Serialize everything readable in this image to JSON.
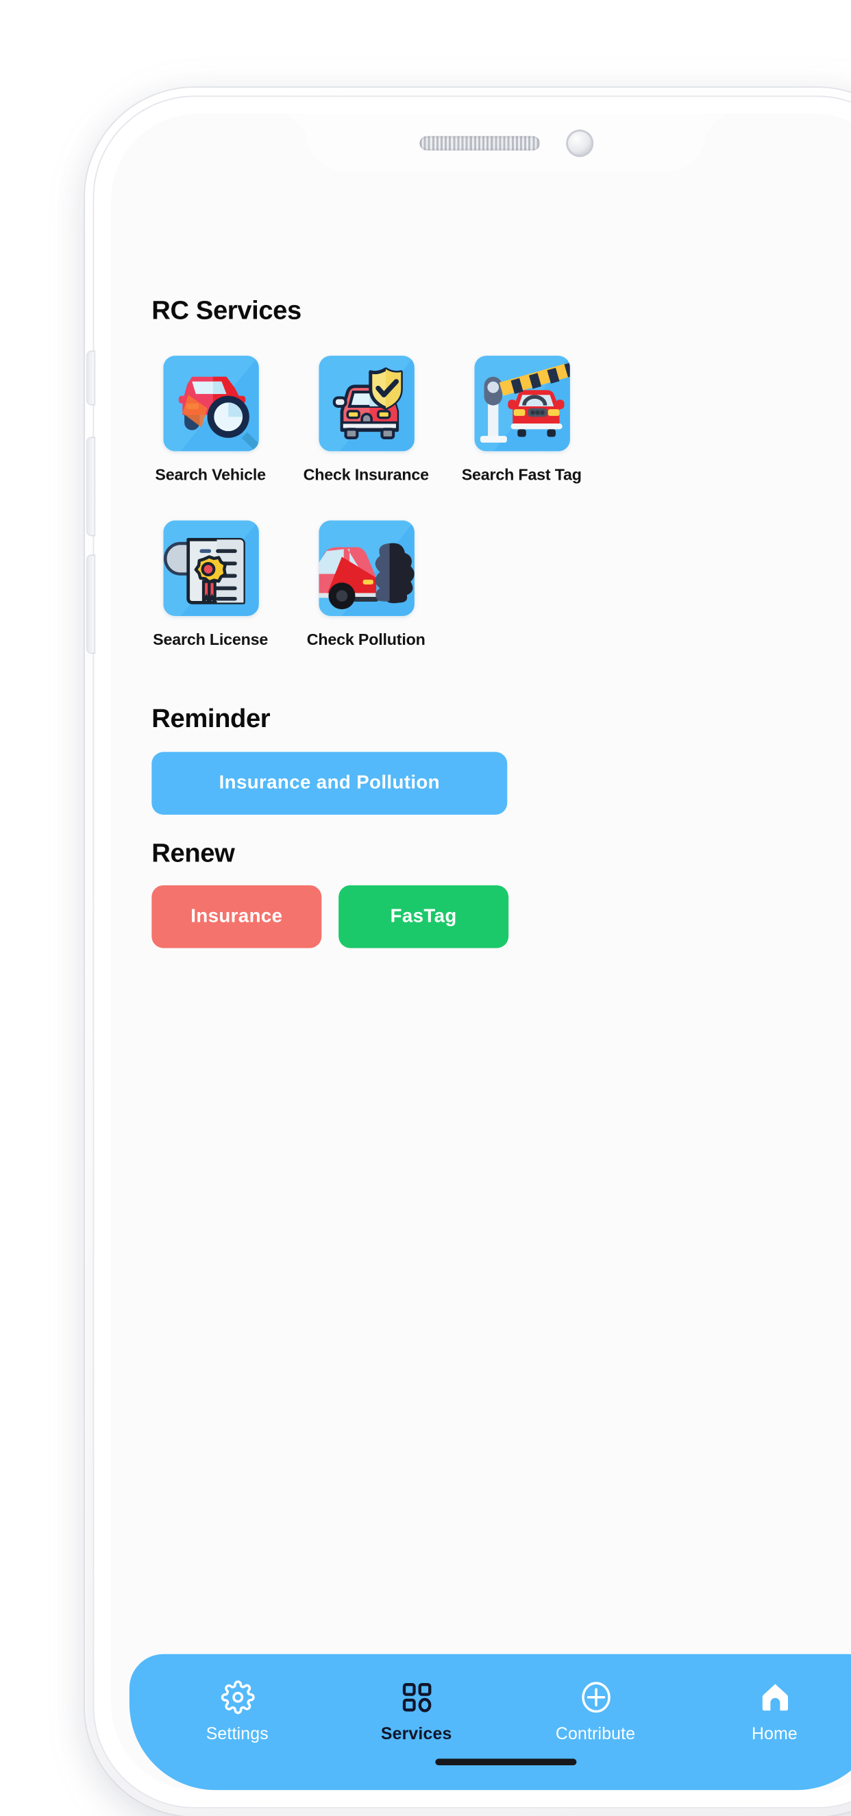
{
  "device": {
    "frame_color": "#f4f4f6",
    "screen_bg": "#fbfbfb",
    "notch": {
      "speaker_icon": "speaker-grille-icon",
      "camera_icon": "front-camera-icon"
    },
    "home_indicator_color": "#16181c"
  },
  "colors": {
    "accent_blue": "#53b9fa",
    "tile_blue": "#56bdf7",
    "renew_insurance_red": "#f4736c",
    "renew_fastag_green": "#1cc96a",
    "text_dark": "#0c0c0c",
    "nav_active": "#10152b",
    "nav_inactive": "#ffffff"
  },
  "sections": {
    "rc_services": {
      "title": "RC Services",
      "items": [
        {
          "label": "Search Vehicle",
          "icon": "car-magnifier-icon"
        },
        {
          "label": "Check Insurance",
          "icon": "car-shield-check-icon"
        },
        {
          "label": "Search Fast Tag",
          "icon": "toll-barrier-car-icon"
        },
        {
          "label": "Search License",
          "icon": "certificate-rosette-icon"
        },
        {
          "label": "Check Pollution",
          "icon": "car-exhaust-smoke-icon"
        }
      ]
    },
    "reminder": {
      "title": "Reminder",
      "button_label": "Insurance and Pollution"
    },
    "renew": {
      "title": "Renew",
      "buttons": [
        {
          "label": "Insurance",
          "color": "#f4736c"
        },
        {
          "label": "FasTag",
          "color": "#1cc96a"
        }
      ]
    }
  },
  "bottom_nav": {
    "active_index": 1,
    "items": [
      {
        "label": "Settings",
        "icon": "gear-icon"
      },
      {
        "label": "Services",
        "icon": "grid-apps-icon"
      },
      {
        "label": "Contribute",
        "icon": "plus-circle-icon"
      },
      {
        "label": "Home",
        "icon": "home-icon"
      }
    ]
  }
}
